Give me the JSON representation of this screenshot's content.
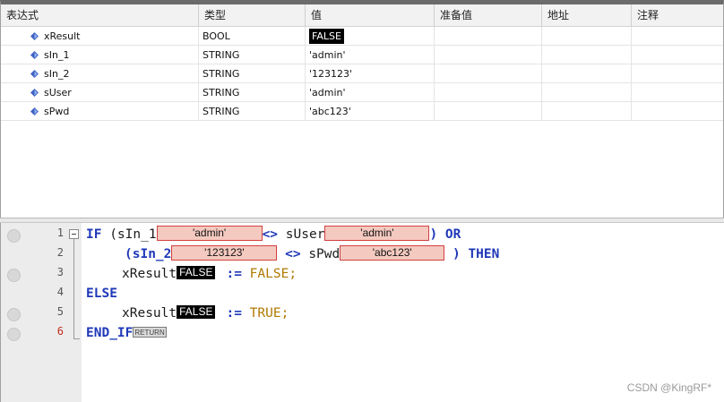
{
  "watch": {
    "columns": [
      "表达式",
      "类型",
      "值",
      "准备值",
      "地址",
      "注释"
    ],
    "rows": [
      {
        "name": "xResult",
        "type": "BOOL",
        "value": "FALSE"
      },
      {
        "name": "sIn_1",
        "type": "STRING",
        "value": "'admin'"
      },
      {
        "name": "sIn_2",
        "type": "STRING",
        "value": "'123123'"
      },
      {
        "name": "sUser",
        "type": "STRING",
        "value": "'admin'"
      },
      {
        "name": "sPwd",
        "type": "STRING",
        "value": "'abc123'"
      }
    ]
  },
  "editor": {
    "line_numbers": [
      "1",
      "2",
      "3",
      "4",
      "5",
      "6"
    ],
    "code": {
      "kw_if": "IF",
      "l1_open": " (sIn_1",
      "l1_mon1": "'admin'",
      "l1_op": "<>",
      "l1_var2": " sUser",
      "l1_mon2": "'admin'",
      "l1_close": ")",
      "kw_or": "OR",
      "l2_open": "(sIn_2",
      "l2_mon1": "'123123'",
      "l2_op": "<>",
      "l2_var2": " sPwd",
      "l2_mon2": "'abc123'",
      "l2_close": ")",
      "kw_then": "THEN",
      "l3_var": "xResult",
      "l3_mon": "FALSE",
      "l3_assign": ":=",
      "l3_val": "FALSE;",
      "kw_else": "ELSE",
      "l5_var": "xResult",
      "l5_mon": "FALSE",
      "l5_assign": ":=",
      "l5_val": "TRUE;",
      "kw_end_if": "END_IF",
      "return_tag": "RETURN"
    }
  },
  "watermark": "CSDN @KingRF*",
  "colors": {
    "keyword": "#1f38b8",
    "literal": "#b07a00",
    "monitor_string_bg": "#f4c9bf",
    "monitor_border": "#d24040",
    "bool_bg": "#000000"
  },
  "icons": {
    "variable": "variable-icon",
    "breakpoint": "breakpoint-marker-icon",
    "fold": "fold-collapse-icon"
  }
}
